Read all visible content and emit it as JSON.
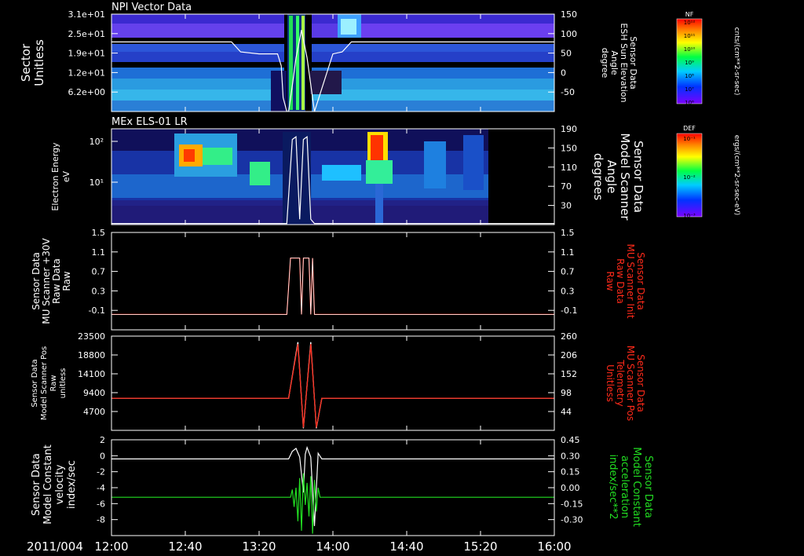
{
  "date_label": "2011/004",
  "x_axis": {
    "start": "12:00",
    "end": "16:00",
    "tick_labels": [
      "12:00",
      "12:40",
      "13:20",
      "14:00",
      "14:40",
      "15:20",
      "16:00"
    ]
  },
  "colors": {
    "background": "#000000",
    "axes": "#ffffff",
    "red_series": "#ff2a1a",
    "green_series": "#22dd22",
    "white_series": "#ffffff"
  },
  "chart_data": [
    {
      "type": "heatmap",
      "title": "NPI Vector Data",
      "ylabel": [
        "Sector",
        "Unitless"
      ],
      "y_tick_labels": [
        "3.1e+01",
        "2.5e+01",
        "1.9e+01",
        "1.2e+01",
        "6.2e+00"
      ],
      "ylabel_right": [
        "Sensor Data",
        "ESH Sun Elevation",
        "Angle",
        "degree"
      ],
      "y_tick_labels_right": [
        "150",
        "100",
        "50",
        "0",
        "-50"
      ],
      "ylim_right": [
        -95,
        150
      ],
      "colorbar": {
        "label": "NF",
        "unit": "cnts/(cm**2-sr-sec)",
        "tick_labels": [
          "10¹²",
          "10¹¹",
          "10¹⁰",
          "10⁹",
          "10⁸",
          "10⁷",
          "10⁶"
        ]
      },
      "overlay_series": {
        "name": "ESH Sun Elevation Angle",
        "color": "#ffffff",
        "x": [
          "12:00",
          "13:05",
          "13:10",
          "13:20",
          "13:30",
          "13:32",
          "13:33",
          "13:35",
          "13:36",
          "13:38",
          "13:40",
          "13:43",
          "13:46",
          "13:50",
          "14:00",
          "14:05",
          "14:10",
          "16:00"
        ],
        "values": [
          80,
          80,
          55,
          50,
          50,
          20,
          -60,
          -95,
          -95,
          -30,
          40,
          110,
          40,
          -95,
          50,
          55,
          80,
          80
        ]
      }
    },
    {
      "type": "heatmap",
      "title": "MEx ELS-01 LR",
      "ylabel": [
        "Electron Energy",
        "eV"
      ],
      "y_tick_labels": [
        "10²",
        "10¹"
      ],
      "ylabel_right": [
        "Sensor Data",
        "Model Scanner",
        "Angle",
        "degrees"
      ],
      "y_tick_labels_right": [
        "190",
        "150",
        "110",
        "70",
        "30"
      ],
      "ylim_right": [
        10,
        190
      ],
      "colorbar": {
        "label": "DEF",
        "unit": "ergs/(cm**2-sr-sec-eV)",
        "tick_labels": [
          "10⁻¹",
          "10⁻²",
          "10⁻³"
        ]
      },
      "overlay_series": {
        "name": "Model Scanner Angle",
        "color": "#ffffff",
        "x": [
          "12:00",
          "13:35",
          "13:38",
          "13:40",
          "13:42",
          "13:44",
          "13:46",
          "13:48",
          "13:50",
          "16:00"
        ],
        "values": [
          12,
          12,
          170,
          175,
          20,
          170,
          175,
          20,
          12,
          12
        ]
      }
    },
    {
      "type": "line",
      "ylabel": [
        "Sensor Data",
        "MU Scanner +30V",
        "Raw Data",
        "Raw"
      ],
      "ylim": [
        -0.4,
        1.5
      ],
      "y_tick_labels": [
        "1.5",
        "1.1",
        "0.7",
        "0.3",
        "-0.1"
      ],
      "ylabel_right": [
        "Sensor Data",
        "MU Scanner Init",
        "Raw Data",
        "Raw"
      ],
      "y_tick_labels_right": [
        "1.5",
        "1.1",
        "0.7",
        "0.3",
        "-0.1"
      ],
      "series": [
        {
          "name": "MU Scanner Init Raw Data",
          "color": "#ff2a1a",
          "x": [
            "12:00",
            "13:35",
            "13:37",
            "13:42",
            "13:43",
            "13:44",
            "13:47",
            "13:48",
            "13:49",
            "13:50",
            "16:00"
          ],
          "values": [
            -0.1,
            -0.1,
            1.0,
            1.0,
            -0.1,
            1.0,
            1.0,
            -0.1,
            1.0,
            -0.1,
            -0.1
          ]
        },
        {
          "name": "MU Scanner +30V Raw Data",
          "color": "#ffffff",
          "x": [
            "12:00",
            "13:35",
            "13:37",
            "13:42",
            "13:43",
            "13:44",
            "13:47",
            "13:48",
            "13:49",
            "13:50",
            "16:00"
          ],
          "values": [
            -0.1,
            -0.1,
            1.0,
            1.0,
            -0.1,
            1.0,
            1.0,
            -0.1,
            1.0,
            -0.1,
            -0.1
          ]
        }
      ]
    },
    {
      "type": "line",
      "ylabel": [
        "Sensor Data",
        "Model Scanner Pos",
        "Raw",
        "unitless"
      ],
      "ylim": [
        0,
        23500
      ],
      "y_tick_labels": [
        "23500",
        "18800",
        "14100",
        "9400",
        "4700"
      ],
      "ylabel_right": [
        "Sensor Data",
        "MU Scanner Pos",
        "Telemetry",
        "Unitless"
      ],
      "y_tick_labels_right": [
        "260",
        "206",
        "152",
        "98",
        "44"
      ],
      "series": [
        {
          "name": "Model Scanner Pos Raw",
          "color": "#ffffff",
          "x": [
            "12:00",
            "13:36",
            "13:41",
            "13:44",
            "13:48",
            "13:51",
            "13:54",
            "16:00"
          ],
          "values": [
            8000,
            8000,
            22000,
            500,
            22000,
            500,
            8000,
            8000
          ]
        },
        {
          "name": "MU Scanner Pos Telemetry",
          "color": "#ff2a1a",
          "x": [
            "12:00",
            "13:36",
            "13:41",
            "13:44",
            "13:48",
            "13:51",
            "13:54",
            "16:00"
          ],
          "values": [
            8000,
            8000,
            21500,
            700,
            21500,
            700,
            8000,
            8000
          ]
        }
      ]
    },
    {
      "type": "line",
      "ylabel": [
        "Sensor Data",
        "Model Constant",
        "velocity",
        "index/sec"
      ],
      "ylim": [
        -8,
        2
      ],
      "y_tick_labels": [
        "2",
        "0",
        "-2",
        "-4",
        "-6",
        "-8"
      ],
      "ylabel_right": [
        "Sensor Data",
        "Model Constant",
        "acceleration",
        "index/sec**2"
      ],
      "y_tick_labels_right": [
        "0.45",
        "0.30",
        "0.15",
        "0.00",
        "-0.15",
        "-0.30"
      ],
      "series": [
        {
          "name": "Model Constant velocity",
          "color": "#ffffff",
          "x": [
            "12:00",
            "13:36",
            "13:38",
            "13:40",
            "13:42",
            "13:44",
            "13:45",
            "13:46",
            "13:48",
            "13:50",
            "13:52",
            "13:54",
            "16:00"
          ],
          "values": [
            0,
            0,
            0.8,
            1.1,
            0.2,
            -3.5,
            0.5,
            1.2,
            0.2,
            -7.0,
            0.6,
            0,
            0
          ]
        },
        {
          "name": "Model Constant acceleration",
          "color": "#22dd22",
          "x": [
            "12:00",
            "13:37",
            "13:38",
            "13:39",
            "13:40",
            "13:41",
            "13:42",
            "13:43",
            "13:44",
            "13:45",
            "13:46",
            "13:47",
            "13:48",
            "13:49",
            "13:50",
            "13:51",
            "13:52",
            "13:53",
            "16:00"
          ],
          "values": [
            -4,
            -4,
            -3.2,
            -5.0,
            -3.0,
            -6.5,
            -2.0,
            -7.5,
            -1.5,
            -4.8,
            -2.5,
            -6.0,
            -1.8,
            -7.8,
            -2.2,
            -5.5,
            -3.0,
            -4,
            -4
          ]
        }
      ]
    }
  ]
}
